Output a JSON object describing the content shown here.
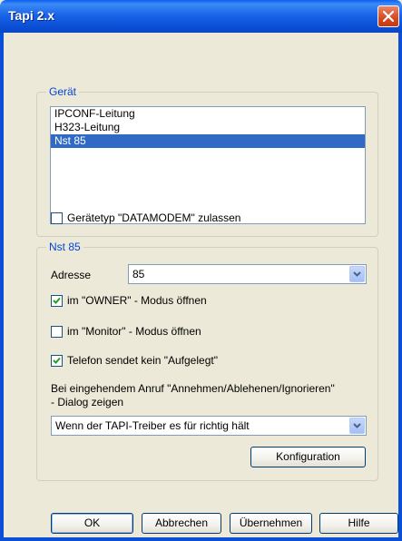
{
  "window": {
    "title": "Tapi 2.x"
  },
  "group_device": {
    "label": "Gerät",
    "items": [
      "IPCONF-Leitung",
      "H323-Leitung",
      "Nst 85"
    ],
    "selected_index": 2,
    "datamodem_checkbox": {
      "label": "Gerätetyp \"DATAMODEM\" zulassen",
      "checked": false
    }
  },
  "group_nst": {
    "label": "Nst 85",
    "address_label": "Adresse",
    "address_value": "85",
    "owner_checkbox": {
      "label": "im \"OWNER\" - Modus öffnen",
      "checked": true
    },
    "monitor_checkbox": {
      "label": "im \"Monitor\" - Modus öffnen",
      "checked": false
    },
    "hangup_checkbox": {
      "label": "Telefon sendet kein \"Aufgelegt\"",
      "checked": true
    },
    "incoming_text_1": "Bei eingehendem Anruf \"Annehmen/Ablehenen/Ignorieren\"",
    "incoming_text_2": "- Dialog zeigen",
    "incoming_value": "Wenn der TAPI-Treiber es für richtig hält",
    "config_button": "Konfiguration"
  },
  "buttons": {
    "ok": "OK",
    "cancel": "Abbrechen",
    "apply": "Übernehmen",
    "help": "Hilfe"
  },
  "colors": {
    "titlebar": "#0a4fd6",
    "selection": "#316ac5",
    "group_label": "#0046d5",
    "background": "#ece9d8"
  }
}
